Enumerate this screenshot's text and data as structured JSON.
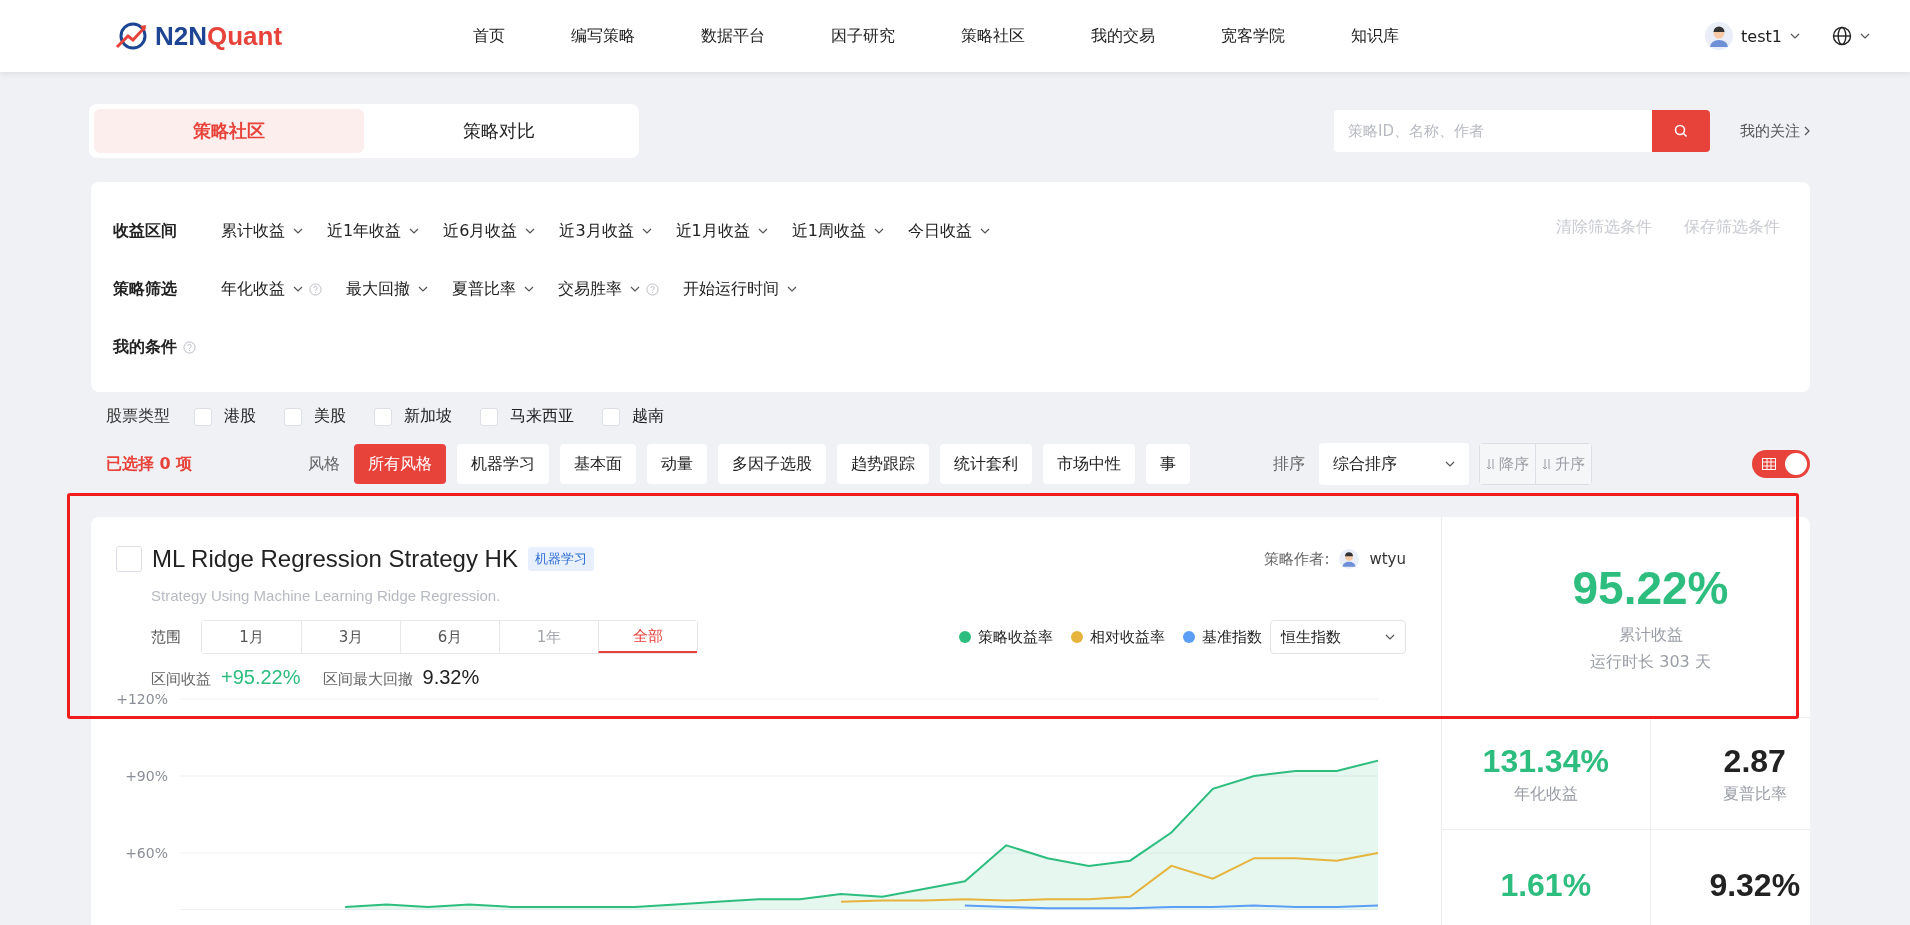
{
  "header": {
    "brand_prefix": "N2N",
    "brand_suffix": "Quant",
    "nav": [
      {
        "label": "首页"
      },
      {
        "label": "编写策略"
      },
      {
        "label": "数据平台"
      },
      {
        "label": "因子研究"
      },
      {
        "label": "策略社区"
      },
      {
        "label": "我的交易"
      },
      {
        "label": "宽客学院"
      },
      {
        "label": "知识库"
      }
    ],
    "user": "test1"
  },
  "tabs": [
    {
      "label": "策略社区",
      "selected": true
    },
    {
      "label": "策略对比",
      "selected": false
    }
  ],
  "search": {
    "placeholder": "策略ID、名称、作者"
  },
  "follow_link": "我的关注",
  "filters": {
    "rows": [
      {
        "label": "收益区间",
        "options": [
          {
            "label": "累计收益"
          },
          {
            "label": "近1年收益"
          },
          {
            "label": "近6月收益"
          },
          {
            "label": "近3月收益"
          },
          {
            "label": "近1月收益"
          },
          {
            "label": "近1周收益"
          },
          {
            "label": "今日收益"
          }
        ]
      },
      {
        "label": "策略筛选",
        "options": [
          {
            "label": "年化收益",
            "help": true
          },
          {
            "label": "最大回撤"
          },
          {
            "label": "夏普比率"
          },
          {
            "label": "交易胜率",
            "help": true
          },
          {
            "label": "开始运行时间"
          }
        ]
      },
      {
        "label": "我的条件",
        "help": true,
        "options": []
      }
    ],
    "actions": [
      {
        "label": "清除筛选条件",
        "disabled": true
      },
      {
        "label": "保存筛选条件",
        "disabled": true
      }
    ]
  },
  "stock_types": {
    "label": "股票类型",
    "items": [
      {
        "label": "港股",
        "checked": false
      },
      {
        "label": "美股",
        "checked": false
      },
      {
        "label": "新加坡",
        "checked": false
      },
      {
        "label": "马来西亚",
        "checked": false
      },
      {
        "label": "越南",
        "checked": false
      }
    ]
  },
  "selection_count": "已选择 0 项",
  "styles": {
    "label": "风格",
    "items": [
      {
        "label": "所有风格",
        "selected": true
      },
      {
        "label": "机器学习",
        "selected": false
      },
      {
        "label": "基本面",
        "selected": false
      },
      {
        "label": "动量",
        "selected": false
      },
      {
        "label": "多因子选股",
        "selected": false
      },
      {
        "label": "趋势跟踪",
        "selected": false
      },
      {
        "label": "统计套利",
        "selected": false
      },
      {
        "label": "市场中性",
        "selected": false
      },
      {
        "label": "事",
        "selected": false
      }
    ]
  },
  "sort": {
    "label": "排序",
    "value": "综合排序",
    "buttons": [
      {
        "label": "降序",
        "disabled": true
      },
      {
        "label": "升序",
        "disabled": true
      }
    ]
  },
  "view_toggle": {
    "on": true
  },
  "strategy_card": {
    "checked": false,
    "title": "ML Ridge Regression Strategy HK",
    "tag": "机器学习",
    "author_label": "策略作者:",
    "author": "wtyu",
    "description": "Strategy Using Machine Learning Ridge Regression.",
    "range_label": "范围",
    "ranges": [
      {
        "label": "1月",
        "selected": false,
        "disabled": false
      },
      {
        "label": "3月",
        "selected": false,
        "disabled": false
      },
      {
        "label": "6月",
        "selected": false,
        "disabled": false
      },
      {
        "label": "1年",
        "selected": false,
        "disabled": true
      },
      {
        "label": "全部",
        "selected": true,
        "disabled": false
      }
    ],
    "benchmark": "恒生指数",
    "period_return_label": "区间收益",
    "period_return": "+95.22%",
    "period_drawdown_label": "区间最大回撤",
    "period_drawdown": "9.32%",
    "chart_data": {
      "type": "line",
      "ylim": [
        38,
        120
      ],
      "yticks": [
        {
          "value": 60,
          "label": "+60%"
        },
        {
          "value": 90,
          "label": "+90%"
        },
        {
          "value": 120,
          "label": "+120%"
        }
      ],
      "series": [
        {
          "name": "策略收益率",
          "color": "#2dbd7e",
          "type": "area",
          "values": [
            null,
            null,
            null,
            null,
            39,
            40,
            39,
            40,
            39,
            39,
            39,
            39,
            40,
            41,
            42,
            42,
            44,
            43,
            46,
            49,
            63,
            58,
            55,
            57,
            68,
            85,
            90,
            92,
            92,
            96
          ]
        },
        {
          "name": "相对收益率",
          "color": "#e6b43c",
          "type": "line",
          "values": [
            null,
            null,
            null,
            null,
            null,
            null,
            null,
            null,
            null,
            null,
            null,
            null,
            null,
            null,
            null,
            null,
            41,
            41.5,
            41.5,
            42,
            41.5,
            42,
            42,
            43,
            55,
            50,
            58,
            58,
            57,
            60
          ]
        },
        {
          "name": "基准指数",
          "color": "#5b9ef5",
          "type": "line",
          "values": [
            null,
            null,
            null,
            null,
            null,
            null,
            null,
            null,
            null,
            null,
            null,
            null,
            null,
            null,
            null,
            null,
            null,
            null,
            null,
            39.5,
            39,
            38.5,
            38.5,
            38.5,
            39,
            39,
            39.5,
            39,
            39,
            39.5
          ]
        }
      ]
    },
    "summary": {
      "value": "95.22%",
      "label": "累计收益",
      "runtime": "运行时长 303 天"
    },
    "metrics": [
      {
        "value": "131.34%",
        "label": "年化收益",
        "positive": true
      },
      {
        "value": "2.87",
        "label": "夏普比率",
        "positive": false
      },
      {
        "value": "1.61%",
        "positive": true
      },
      {
        "value": "9.32%",
        "positive": false
      }
    ]
  }
}
